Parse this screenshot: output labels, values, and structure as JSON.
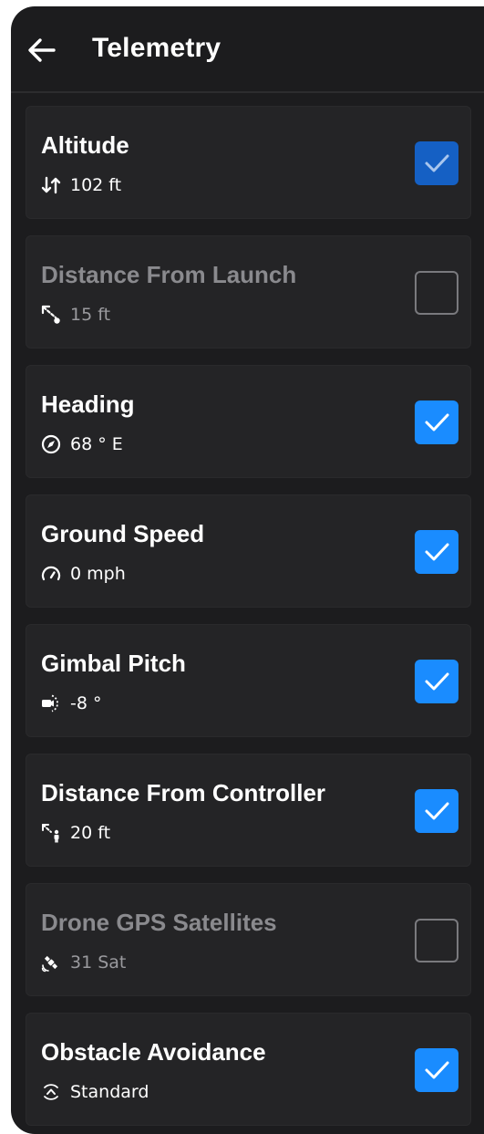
{
  "header": {
    "title": "Telemetry",
    "back_icon": "arrow-left-icon"
  },
  "colors": {
    "background": "#1c1c1e",
    "card": "#242426",
    "accent": "#1a8cff",
    "disabled_text": "#8a8a8e"
  },
  "items": [
    {
      "title": "Altitude",
      "value": "102 ft",
      "icon": "altitude-arrows-icon",
      "checked": true,
      "enabled": false
    },
    {
      "title": "Distance From Launch",
      "value": "15 ft",
      "icon": "distance-from-launch-icon",
      "checked": false,
      "enabled": false
    },
    {
      "title": "Heading",
      "value": "68 ° E",
      "icon": "compass-icon",
      "checked": true,
      "enabled": true
    },
    {
      "title": "Ground Speed",
      "value": "0 mph",
      "icon": "speedometer-icon",
      "checked": true,
      "enabled": true
    },
    {
      "title": "Gimbal Pitch",
      "value": "-8 °",
      "icon": "gimbal-camera-icon",
      "checked": true,
      "enabled": true
    },
    {
      "title": "Distance From Controller",
      "value": "20 ft",
      "icon": "distance-from-controller-icon",
      "checked": true,
      "enabled": true
    },
    {
      "title": "Drone GPS Satellites",
      "value": "31 Sat",
      "icon": "satellite-icon",
      "checked": false,
      "enabled": false
    },
    {
      "title": "Obstacle Avoidance",
      "value": "Standard",
      "icon": "obstacle-avoidance-icon",
      "checked": true,
      "enabled": true
    }
  ]
}
